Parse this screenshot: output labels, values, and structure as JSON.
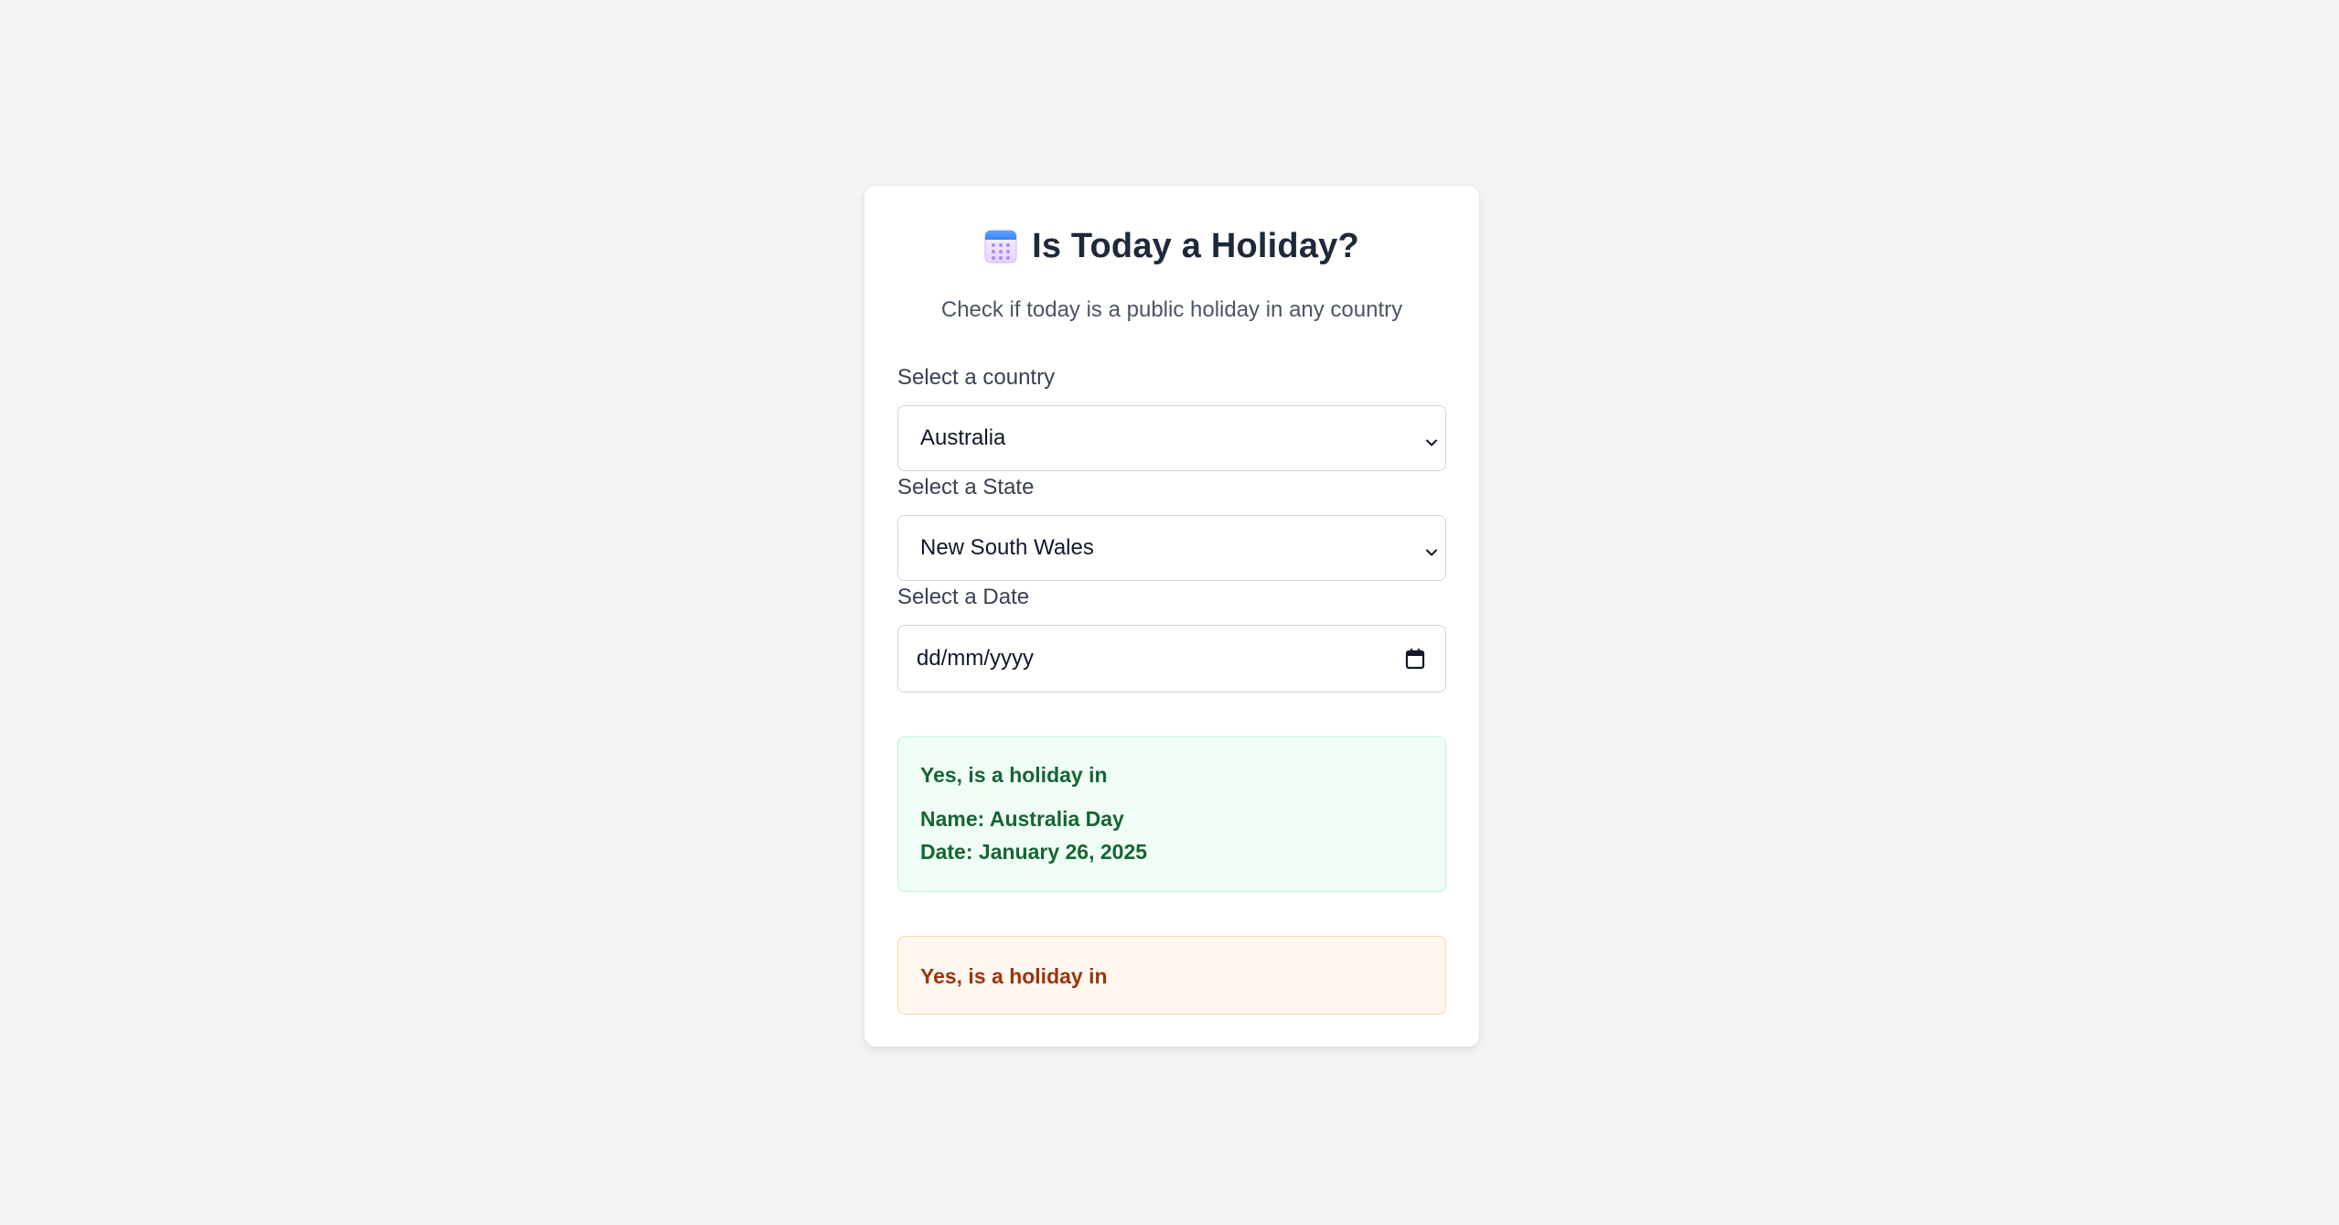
{
  "header": {
    "title": "Is Today a Holiday?",
    "icon": "calendar-icon",
    "subtitle": "Check if today is a public holiday in any country"
  },
  "form": {
    "country": {
      "label": "Select a country",
      "value": "Australia"
    },
    "state": {
      "label": "Select a State",
      "value": "New South Wales"
    },
    "date": {
      "label": "Select a Date",
      "placeholder": "dd/mm/yyyy",
      "icon": "calendar-picker-icon"
    }
  },
  "results": {
    "primary": {
      "heading": "Yes, is a holiday in",
      "name": "Name: Australia Day",
      "date": "Date: January 26, 2025"
    },
    "secondary": {
      "heading": "Yes, is a holiday in"
    }
  },
  "colors": {
    "background": "#f3f4f6",
    "success_bg": "#f0fdf4",
    "success_text": "#166534",
    "warning_bg": "#fff7ed",
    "warning_text": "#9a3412",
    "title_text": "#1e293b"
  }
}
